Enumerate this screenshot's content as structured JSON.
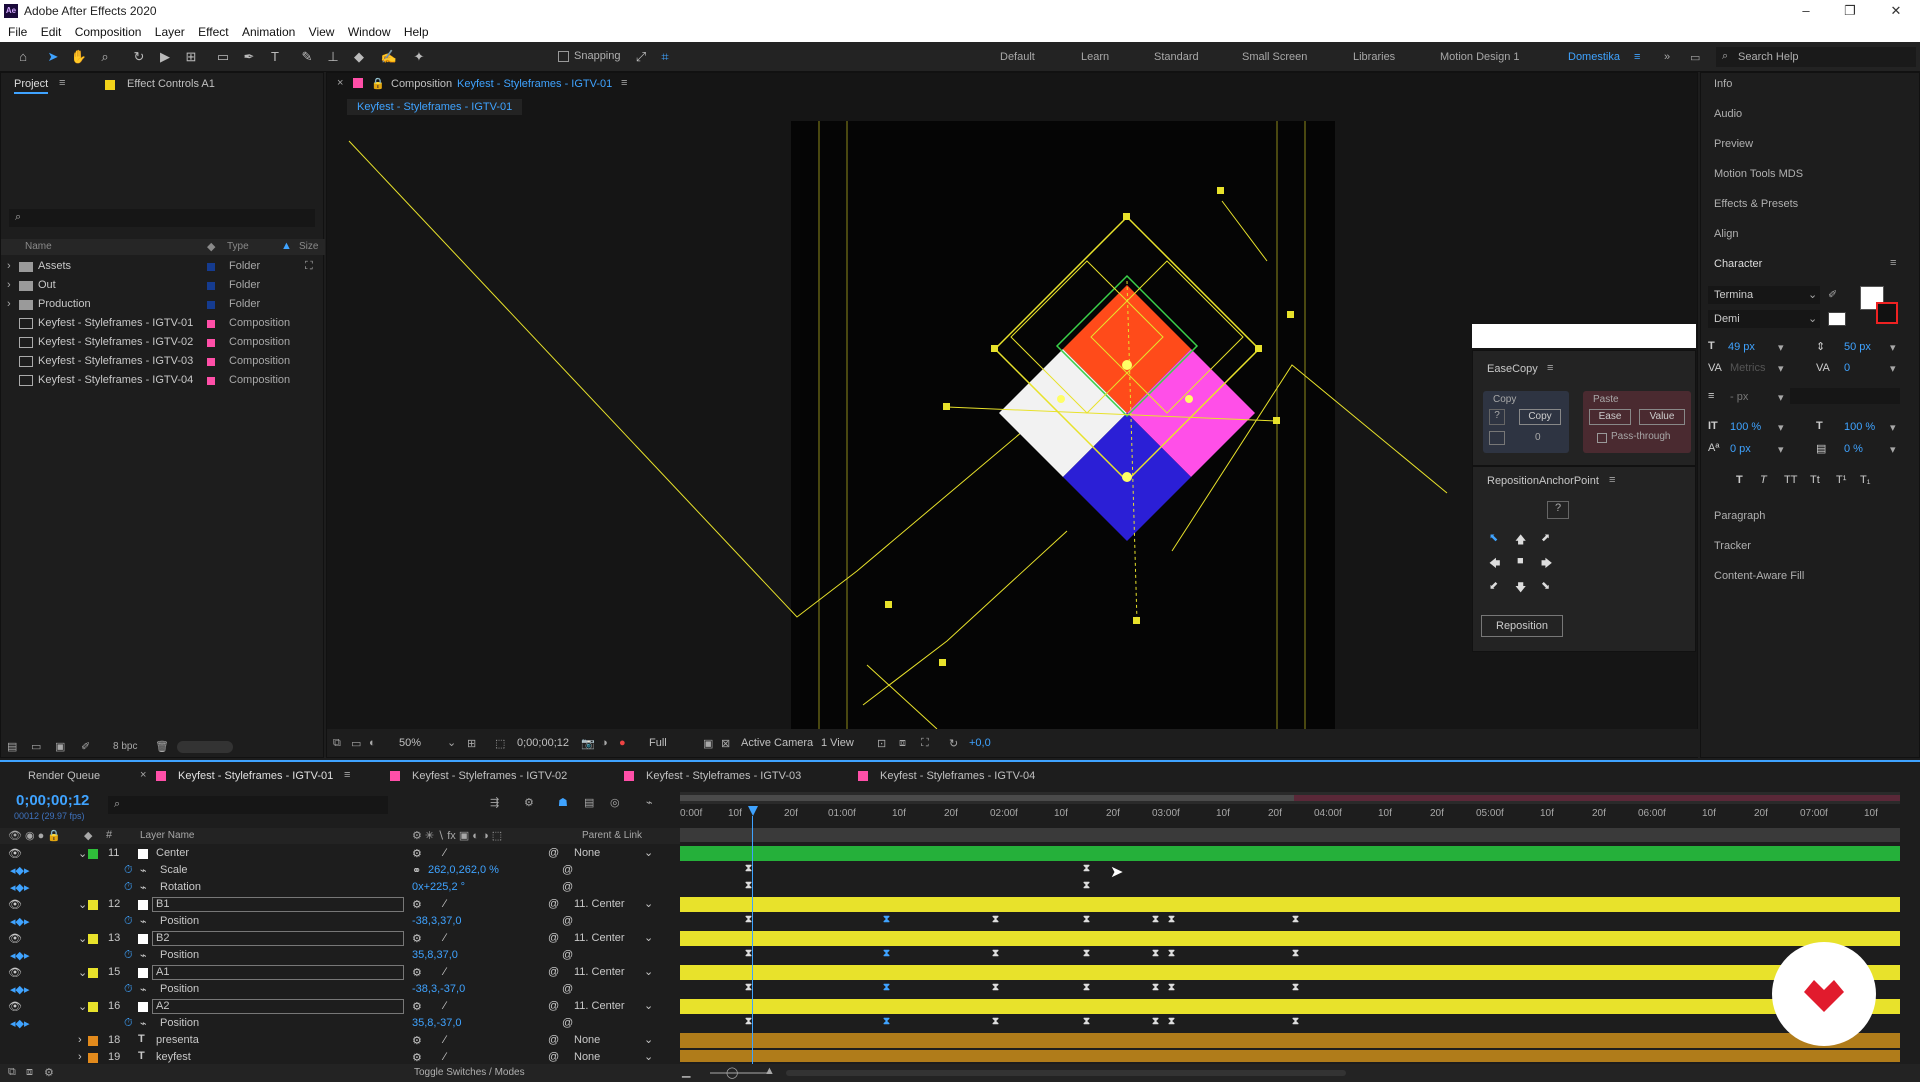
{
  "app": {
    "title": "Adobe After Effects 2020",
    "icon": "Ae"
  },
  "menu": [
    "File",
    "Edit",
    "Composition",
    "Layer",
    "Effect",
    "Animation",
    "View",
    "Window",
    "Help"
  ],
  "toolbar": {
    "snapping": "Snapping"
  },
  "workspaces": [
    "Default",
    "Learn",
    "Standard",
    "Small Screen",
    "Libraries",
    "Motion Design 1",
    "Domestika"
  ],
  "search_help": "Search Help",
  "project": {
    "tab": "Project",
    "effect_controls_tab": "Effect Controls A1",
    "columns": {
      "name": "Name",
      "type": "Type",
      "size": "Size"
    },
    "items": [
      {
        "name": "Assets",
        "type": "Folder"
      },
      {
        "name": "Out",
        "type": "Folder"
      },
      {
        "name": "Production",
        "type": "Folder"
      },
      {
        "name": "Keyfest - Styleframes - IGTV-01",
        "type": "Composition"
      },
      {
        "name": "Keyfest - Styleframes - IGTV-02",
        "type": "Composition"
      },
      {
        "name": "Keyfest - Styleframes - IGTV-03",
        "type": "Composition"
      },
      {
        "name": "Keyfest - Styleframes - IGTV-04",
        "type": "Composition"
      }
    ],
    "bpc": "8 bpc"
  },
  "composition": {
    "label": "Composition",
    "name": "Keyfest - Styleframes - IGTV-01",
    "subtab": "Keyfest - Styleframes - IGTV-01",
    "zoom": "50%",
    "time": "0;00;00;12",
    "resolution": "Full",
    "camera": "Active Camera",
    "views": "1 View",
    "exposure": "+0,0"
  },
  "easecopy": {
    "title": "EaseCopy",
    "copy_label": "Copy",
    "copy_btn": "Copy",
    "help": "?",
    "count": "0",
    "paste_label": "Paste",
    "ease_btn": "Ease",
    "value_btn": "Value",
    "passthrough": "Pass-through"
  },
  "reposition": {
    "title": "RepositionAnchorPoint",
    "help": "?",
    "button": "Reposition"
  },
  "right_panels": [
    "Info",
    "Audio",
    "Preview",
    "Motion Tools MDS",
    "Effects & Presets",
    "Align",
    "Character",
    "Paragraph",
    "Tracker",
    "Content-Aware Fill"
  ],
  "character": {
    "font": "Termina",
    "style": "Demi",
    "size": "49 px",
    "leading": "50 px",
    "kerning": "Metrics",
    "tracking": "0",
    "stroke_unit": "- px",
    "vscale": "100 %",
    "hscale": "100 %",
    "baseline": "0 px",
    "tsume": "0 %",
    "styles": [
      "T",
      "T",
      "TT",
      "Tt",
      "T¹",
      "T₁"
    ]
  },
  "timeline": {
    "tabs": [
      "Render Queue",
      "Keyfest - Styleframes - IGTV-01",
      "Keyfest - Styleframes - IGTV-02",
      "Keyfest - Styleframes - IGTV-03",
      "Keyfest - Styleframes - IGTV-04"
    ],
    "timecode": "0;00;00;12",
    "frames": "00012 (29.97 fps)",
    "col_layer_name": "Layer Name",
    "col_parent": "Parent & Link",
    "ruler": [
      "0:00f",
      "10f",
      "20f",
      "01:00f",
      "10f",
      "20f",
      "02:00f",
      "10f",
      "20f",
      "03:00f",
      "10f",
      "20f",
      "04:00f",
      "10f",
      "20f",
      "05:00f",
      "10f",
      "20f",
      "06:00f",
      "10f",
      "20f",
      "07:00f",
      "10f"
    ],
    "rows": [
      {
        "num": "11",
        "name": "Center",
        "parent": "None",
        "color": "#2fbf3a",
        "kind": "layer"
      },
      {
        "prop": "Scale",
        "value": "262,0,262,0 %"
      },
      {
        "prop": "Rotation",
        "value": "0x+225,2 °"
      },
      {
        "num": "12",
        "name": "B1",
        "parent": "11. Center",
        "color": "#e8e22b",
        "kind": "layer"
      },
      {
        "prop": "Position",
        "value": "-38,3,37,0"
      },
      {
        "num": "13",
        "name": "B2",
        "parent": "11. Center",
        "color": "#e8e22b",
        "kind": "layer"
      },
      {
        "prop": "Position",
        "value": "35,8,37,0"
      },
      {
        "num": "15",
        "name": "A1",
        "parent": "11. Center",
        "color": "#e8e22b",
        "kind": "layer"
      },
      {
        "prop": "Position",
        "value": "-38,3,-37,0"
      },
      {
        "num": "16",
        "name": "A2",
        "parent": "11. Center",
        "color": "#e8e22b",
        "kind": "layer"
      },
      {
        "prop": "Position",
        "value": "35,8,-37,0"
      },
      {
        "num": "18",
        "name": "presenta",
        "parent": "None",
        "color": "#e28a1c",
        "kind": "text"
      },
      {
        "num": "19",
        "name": "keyfest",
        "parent": "None",
        "color": "#e28a1c",
        "kind": "text"
      }
    ],
    "toggle": "Toggle Switches / Modes"
  }
}
